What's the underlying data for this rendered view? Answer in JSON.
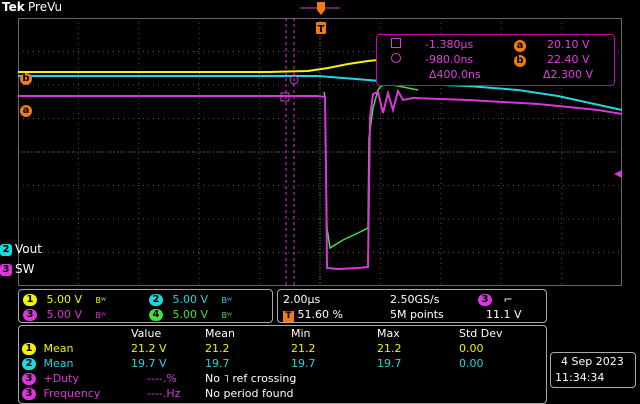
{
  "header": {
    "brand": "Tek",
    "mode": "PreVu"
  },
  "trigger": {
    "marker": "T"
  },
  "channel_labels": [
    {
      "badge": "2",
      "name": "Vout",
      "color": "#20d8e0"
    },
    {
      "badge": "3",
      "name": "SW",
      "color": "#d838d8"
    }
  ],
  "ref_markers": [
    {
      "badge": "b",
      "color": "#f47a12"
    },
    {
      "badge": "a",
      "color": "#f47a12"
    }
  ],
  "cursor_readout": {
    "t_a": "-1.380µs",
    "t_b": "-980.0ns",
    "t_delta": "Δ400.0ns",
    "v_a": "20.10 V",
    "v_b": "22.40 V",
    "v_delta": "Δ2.300 V",
    "badge_a": "a",
    "badge_b": "b"
  },
  "vertical": [
    {
      "badge": "1",
      "value": "5.00 V",
      "color": "#f4f400"
    },
    {
      "badge": "2",
      "value": "5.00 V",
      "color": "#20d8e0"
    },
    {
      "badge": "3",
      "value": "5.00 V",
      "color": "#d838d8"
    },
    {
      "badge": "4",
      "value": "5.00 V",
      "color": "#40e040"
    }
  ],
  "bw_mark": "Bᵂ",
  "timebase": {
    "scale": "2.00µs",
    "sample_rate": "2.50GS/s",
    "trigger_pos": "51.60 %",
    "record": "5M points",
    "trigger_source": "3",
    "trigger_level": "11.1 V",
    "trigger_badge": "T"
  },
  "measurements": {
    "headers": [
      "Value",
      "Mean",
      "Min",
      "Max",
      "Std Dev"
    ],
    "rows": [
      {
        "badge": "1",
        "label": "Mean",
        "color": "#f4f400",
        "value": "21.2 V",
        "mean": "21.2",
        "min": "21.2",
        "max": "21.2",
        "std": "0.00"
      },
      {
        "badge": "2",
        "label": "Mean",
        "color": "#20d8e0",
        "value": "19.7 V",
        "mean": "19.7",
        "min": "19.7",
        "max": "19.7",
        "std": "0.00"
      },
      {
        "badge": "3",
        "label": "+Duty",
        "color": "#d838d8",
        "value": "----.%",
        "note": "No ˥ ref crossing"
      },
      {
        "badge": "3",
        "label": "Frequency",
        "color": "#d838d8",
        "value": "----.Hz",
        "note": "No period found"
      }
    ]
  },
  "datetime": {
    "date": "4 Sep  2023",
    "time": "11:34:34"
  }
}
